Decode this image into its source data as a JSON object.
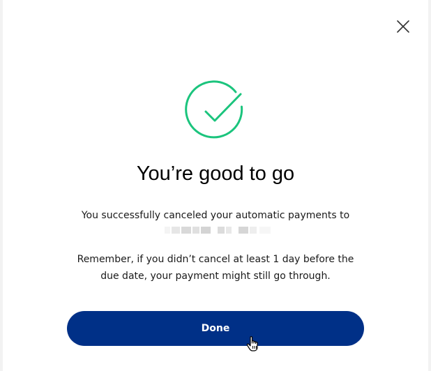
{
  "dialog": {
    "close_icon": "close-icon",
    "success_icon": "check-circle-icon",
    "title": "You’re good to go",
    "message": "You successfully canceled your automatic payments to",
    "reminder": "Remember, if you didn’t cancel at least 1 day before the due date, your payment might still go through.",
    "done_label": "Done"
  },
  "colors": {
    "accent_green": "#1bc47d",
    "button_blue": "#003087"
  }
}
